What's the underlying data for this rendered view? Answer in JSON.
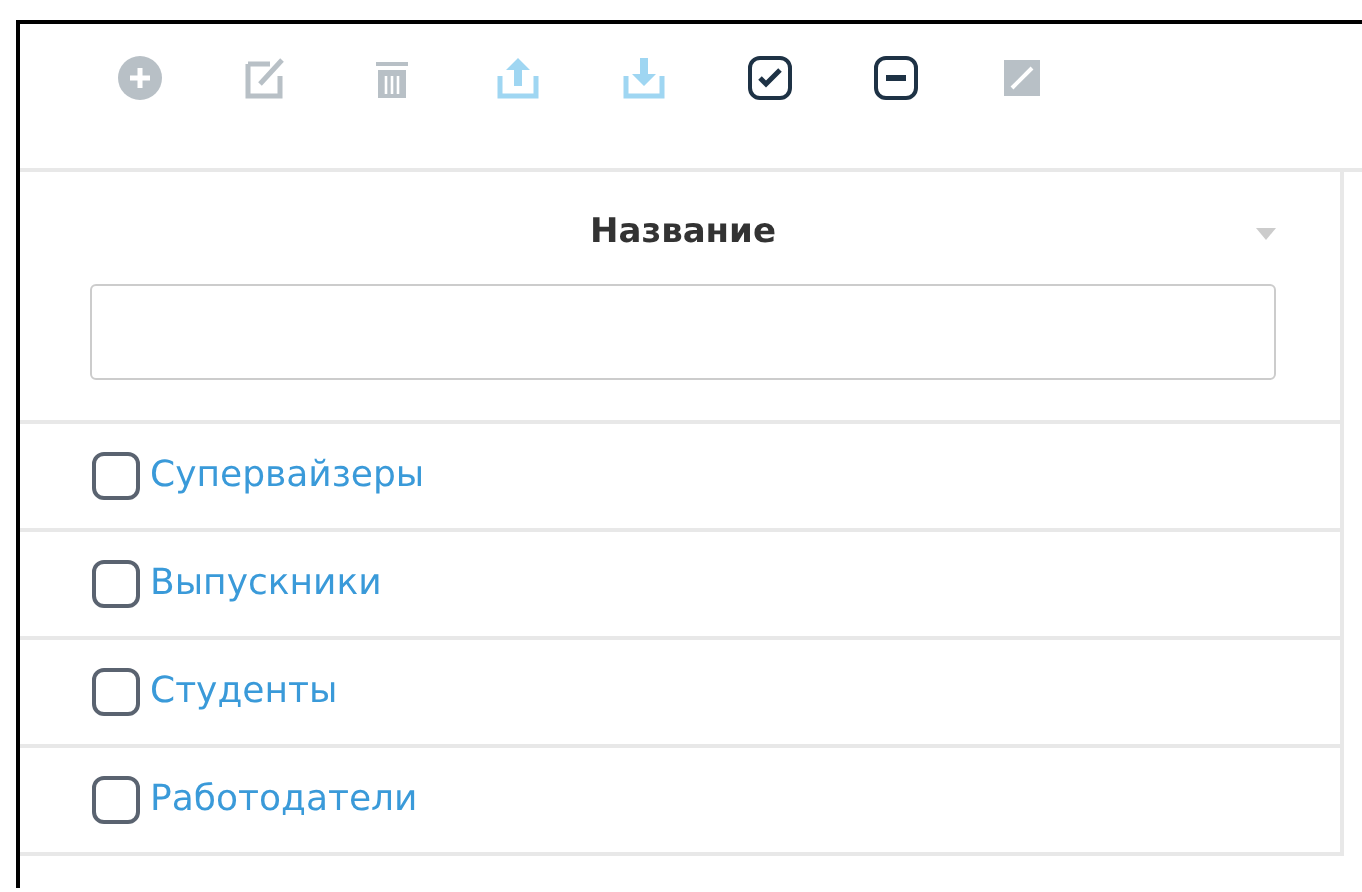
{
  "toolbar": [
    {
      "kind": "add",
      "disabled": true
    },
    {
      "kind": "edit",
      "disabled": true
    },
    {
      "kind": "delete",
      "disabled": true
    },
    {
      "kind": "upload",
      "disabled": false
    },
    {
      "kind": "download",
      "disabled": false
    },
    {
      "kind": "check-all",
      "disabled": false
    },
    {
      "kind": "uncheck-all",
      "disabled": false
    },
    {
      "kind": "image",
      "disabled": true
    }
  ],
  "table": {
    "columns": [
      {
        "label": "Название"
      }
    ],
    "rows": [
      {
        "name": "Супервайзеры",
        "checked": false
      },
      {
        "name": "Выпускники",
        "checked": false
      },
      {
        "name": "Студенты",
        "checked": false
      },
      {
        "name": "Работодатели",
        "checked": false
      }
    ]
  }
}
